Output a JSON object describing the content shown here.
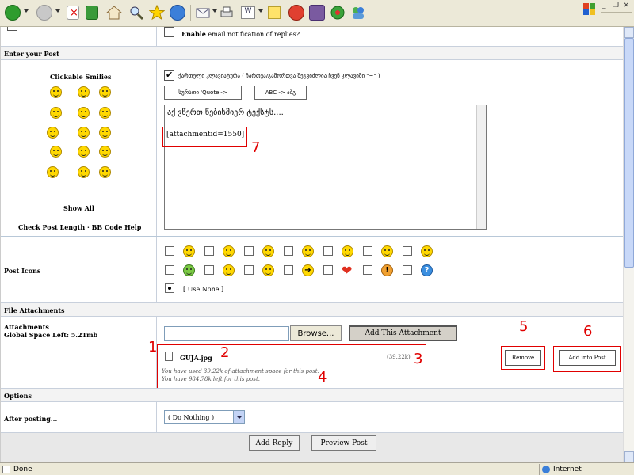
{
  "notify": {
    "label_bold": "Enable",
    "label_rest": " email notification of replies?"
  },
  "sections": {
    "enter_post": "Enter your Post",
    "file_attachments": "File Attachments",
    "options": "Options"
  },
  "left": {
    "clickable_smilies": "Clickable Smilies",
    "show_all": "Show All",
    "check_post_length": "Check Post Length",
    "sep": "·",
    "bb_code_help": "BB Code Help",
    "post_icons": "Post Icons",
    "attachments": "Attachments",
    "global_space": "Global Space Left: 5.21mb",
    "after_posting": "After posting..."
  },
  "editor": {
    "georgian_label": "ქართული კლავიატურა ( ჩართვა/გამორთვა შეგვიძლია ჩვენ კლავიში \"~\" )",
    "btn_quote": "სურათი 'Quote'->",
    "btn_abc": "ABC -> აბგ",
    "text_line1": "აქ ვწერთ წებისმიერ ტექსტს....",
    "text_line2": "[attachmentid=1550]"
  },
  "post_icons": {
    "use_none": "[ Use None ]"
  },
  "attach": {
    "browse": "Browse...",
    "add_attachment": "Add This Attachment",
    "file_name": "GUJA.jpg",
    "file_size": "(39.22k)",
    "used_text": "You have used 39.22k of attachment space for this post.",
    "left_text": "You have 984.78k left for this post.",
    "remove": "Remove",
    "add_into_post": "Add into Post"
  },
  "options": {
    "after_posting_value": "( Do Nothing )"
  },
  "bottom": {
    "add_reply": "Add Reply",
    "preview_post": "Preview Post"
  },
  "annotations": {
    "n1": "1",
    "n2": "2",
    "n3": "3",
    "n4": "4",
    "n5": "5",
    "n6": "6",
    "n7": "7"
  },
  "status": {
    "done": "Done",
    "zone": "Internet"
  },
  "colors": {
    "annotation_red": "#e00000",
    "section_bg": "#f3f3f3",
    "toolbar_bg": "#ece9d8"
  }
}
